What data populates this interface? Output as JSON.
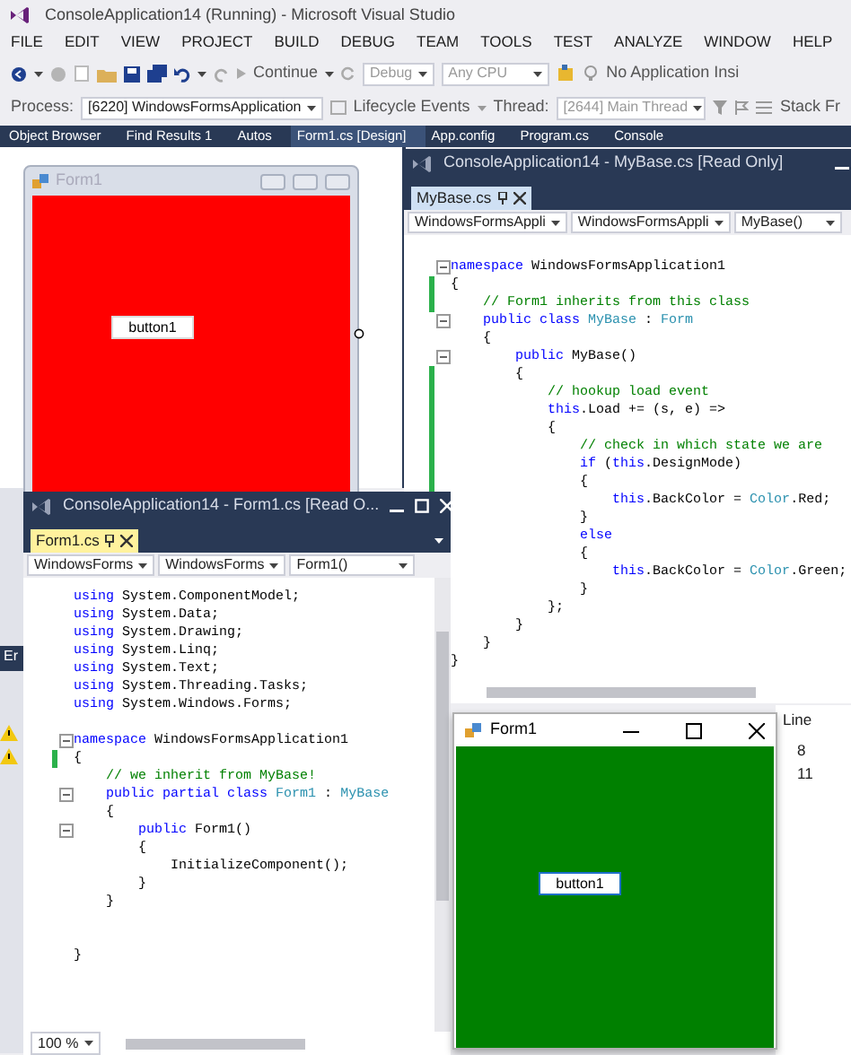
{
  "main_window": {
    "title": "ConsoleApplication14 (Running) - Microsoft Visual Studio",
    "menu": [
      "FILE",
      "EDIT",
      "VIEW",
      "PROJECT",
      "BUILD",
      "DEBUG",
      "TEAM",
      "TOOLS",
      "TEST",
      "ANALYZE",
      "WINDOW",
      "HELP"
    ],
    "toolbar": {
      "continue": "Continue",
      "configuration": "Debug",
      "platform": "Any CPU",
      "insights": "No Application Insi"
    },
    "debug_toolbar": {
      "process_label": "Process:",
      "process": "[6220] WindowsFormsApplication",
      "lifecycle": "Lifecycle Events",
      "thread_label": "Thread:",
      "thread": "[2644] Main Thread",
      "stack": "Stack Fr"
    },
    "doc_tabs": [
      {
        "label": "Object Browser",
        "selected": false
      },
      {
        "label": "Find Results 1",
        "selected": false
      },
      {
        "label": "Autos",
        "selected": false
      },
      {
        "label": "Form1.cs [Design]",
        "selected": true
      },
      {
        "label": "App.config",
        "selected": false
      },
      {
        "label": "Program.cs",
        "selected": false
      },
      {
        "label": "Console",
        "selected": false
      }
    ]
  },
  "designer": {
    "form_title": "Form1",
    "button": "button1"
  },
  "error_list": {
    "tab": "Er",
    "header": "Line",
    "rows": [
      "8",
      "11"
    ]
  },
  "code_windows": [
    {
      "title": "ConsoleApplication14 - MyBase.cs [Read Only]",
      "tab": "MyBase.cs",
      "nav": [
        "WindowsFormsAppli",
        "WindowsFormsAppli",
        "MyBase()"
      ],
      "lines": [
        {
          "kind": "code",
          "fold": true,
          "tokens": [
            {
              "kind": "keyword",
              "text": "namespace"
            },
            {
              "kind": "plain",
              "text": " WindowsFormsApplication1"
            }
          ]
        },
        {
          "kind": "code",
          "changed": true,
          "tokens": [
            {
              "kind": "plain",
              "text": "{"
            }
          ]
        },
        {
          "kind": "code",
          "changed": true,
          "tokens": [
            {
              "kind": "comment",
              "text": "    // Form1 inherits from this class"
            }
          ]
        },
        {
          "kind": "code",
          "fold": true,
          "tokens": [
            {
              "kind": "keyword",
              "text": "    public class "
            },
            {
              "kind": "type",
              "text": "MyBase"
            },
            {
              "kind": "plain",
              "text": " : "
            },
            {
              "kind": "type",
              "text": "Form"
            }
          ]
        },
        {
          "kind": "code",
          "tokens": [
            {
              "kind": "plain",
              "text": "    {"
            }
          ]
        },
        {
          "kind": "code",
          "fold": true,
          "tokens": [
            {
              "kind": "keyword",
              "text": "        public"
            },
            {
              "kind": "plain",
              "text": " MyBase()"
            }
          ]
        },
        {
          "kind": "code",
          "changed": true,
          "tokens": [
            {
              "kind": "plain",
              "text": "        {"
            }
          ]
        },
        {
          "kind": "code",
          "changed": true,
          "tokens": [
            {
              "kind": "comment",
              "text": "            // hookup load event"
            }
          ]
        },
        {
          "kind": "code",
          "changed": true,
          "tokens": [
            {
              "kind": "keyword",
              "text": "            this"
            },
            {
              "kind": "plain",
              "text": ".Load += (s, e) =>"
            }
          ]
        },
        {
          "kind": "code",
          "changed": true,
          "tokens": [
            {
              "kind": "plain",
              "text": "            {"
            }
          ]
        },
        {
          "kind": "code",
          "changed": true,
          "tokens": [
            {
              "kind": "comment",
              "text": "                // check in which state we are"
            }
          ]
        },
        {
          "kind": "code",
          "changed": true,
          "tokens": [
            {
              "kind": "keyword",
              "text": "                if"
            },
            {
              "kind": "plain",
              "text": " ("
            },
            {
              "kind": "keyword",
              "text": "this"
            },
            {
              "kind": "plain",
              "text": ".DesignMode)"
            }
          ]
        },
        {
          "kind": "code",
          "changed": true,
          "tokens": [
            {
              "kind": "plain",
              "text": "                {"
            }
          ]
        },
        {
          "kind": "code",
          "tokens": [
            {
              "kind": "keyword",
              "text": "                    this"
            },
            {
              "kind": "plain",
              "text": ".BackColor = "
            },
            {
              "kind": "type",
              "text": "Color"
            },
            {
              "kind": "plain",
              "text": ".Red;"
            }
          ]
        },
        {
          "kind": "code",
          "tokens": [
            {
              "kind": "plain",
              "text": "                }"
            }
          ]
        },
        {
          "kind": "code",
          "tokens": [
            {
              "kind": "keyword",
              "text": "                else"
            }
          ]
        },
        {
          "kind": "code",
          "tokens": [
            {
              "kind": "plain",
              "text": "                {"
            }
          ]
        },
        {
          "kind": "code",
          "tokens": [
            {
              "kind": "keyword",
              "text": "                    this"
            },
            {
              "kind": "plain",
              "text": ".BackColor = "
            },
            {
              "kind": "type",
              "text": "Color"
            },
            {
              "kind": "plain",
              "text": ".Green;"
            }
          ]
        },
        {
          "kind": "code",
          "tokens": [
            {
              "kind": "plain",
              "text": "                }"
            }
          ]
        },
        {
          "kind": "code",
          "tokens": [
            {
              "kind": "plain",
              "text": "            };"
            }
          ]
        },
        {
          "kind": "code",
          "tokens": [
            {
              "kind": "plain",
              "text": "        }"
            }
          ]
        },
        {
          "kind": "code",
          "tokens": [
            {
              "kind": "plain",
              "text": "    }"
            }
          ]
        },
        {
          "kind": "code",
          "tokens": [
            {
              "kind": "plain",
              "text": "}"
            }
          ]
        }
      ]
    },
    {
      "title": "ConsoleApplication14 - Form1.cs [Read O...",
      "tab": "Form1.cs",
      "nav": [
        "WindowsForms",
        "WindowsForms",
        "Form1()"
      ],
      "zoom": "100 %",
      "lines": [
        {
          "kind": "code",
          "tokens": [
            {
              "kind": "keyword",
              "text": "using"
            },
            {
              "kind": "plain",
              "text": " System.ComponentModel;"
            }
          ]
        },
        {
          "kind": "code",
          "tokens": [
            {
              "kind": "keyword",
              "text": "using"
            },
            {
              "kind": "plain",
              "text": " System.Data;"
            }
          ]
        },
        {
          "kind": "code",
          "tokens": [
            {
              "kind": "keyword",
              "text": "using"
            },
            {
              "kind": "plain",
              "text": " System.Drawing;"
            }
          ]
        },
        {
          "kind": "code",
          "tokens": [
            {
              "kind": "keyword",
              "text": "using"
            },
            {
              "kind": "plain",
              "text": " System.Linq;"
            }
          ]
        },
        {
          "kind": "code",
          "tokens": [
            {
              "kind": "keyword",
              "text": "using"
            },
            {
              "kind": "plain",
              "text": " System.Text;"
            }
          ]
        },
        {
          "kind": "code",
          "tokens": [
            {
              "kind": "keyword",
              "text": "using"
            },
            {
              "kind": "plain",
              "text": " System.Threading.Tasks;"
            }
          ]
        },
        {
          "kind": "code",
          "tokens": [
            {
              "kind": "keyword",
              "text": "using"
            },
            {
              "kind": "plain",
              "text": " System.Windows.Forms;"
            }
          ]
        },
        {
          "kind": "blank"
        },
        {
          "kind": "code",
          "fold": true,
          "tokens": [
            {
              "kind": "keyword",
              "text": "namespace"
            },
            {
              "kind": "plain",
              "text": " WindowsFormsApplication1"
            }
          ]
        },
        {
          "kind": "code",
          "changed": true,
          "tokens": [
            {
              "kind": "plain",
              "text": "{"
            }
          ]
        },
        {
          "kind": "code",
          "tokens": [
            {
              "kind": "comment",
              "text": "    // we inherit from MyBase!"
            }
          ]
        },
        {
          "kind": "code",
          "fold": true,
          "tokens": [
            {
              "kind": "keyword",
              "text": "    public partial class "
            },
            {
              "kind": "type",
              "text": "Form1"
            },
            {
              "kind": "plain",
              "text": " : "
            },
            {
              "kind": "type",
              "text": "MyBase"
            }
          ]
        },
        {
          "kind": "code",
          "tokens": [
            {
              "kind": "plain",
              "text": "    {"
            }
          ]
        },
        {
          "kind": "code",
          "fold": true,
          "tokens": [
            {
              "kind": "keyword",
              "text": "        public"
            },
            {
              "kind": "plain",
              "text": " Form1()"
            }
          ]
        },
        {
          "kind": "code",
          "tokens": [
            {
              "kind": "plain",
              "text": "        {"
            }
          ]
        },
        {
          "kind": "code",
          "tokens": [
            {
              "kind": "plain",
              "text": "            InitializeComponent();"
            }
          ]
        },
        {
          "kind": "code",
          "tokens": [
            {
              "kind": "plain",
              "text": "        }"
            }
          ]
        },
        {
          "kind": "code",
          "tokens": [
            {
              "kind": "plain",
              "text": "    }"
            }
          ]
        },
        {
          "kind": "blank"
        },
        {
          "kind": "blank"
        },
        {
          "kind": "code",
          "tokens": [
            {
              "kind": "plain",
              "text": "}"
            }
          ]
        }
      ]
    }
  ],
  "running_form": {
    "title": "Form1",
    "button": "button1"
  }
}
